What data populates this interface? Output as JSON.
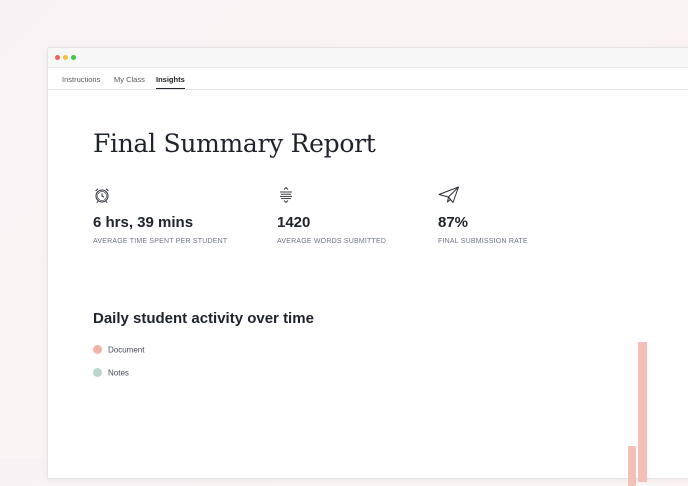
{
  "tabs": [
    {
      "label": "Instructions",
      "active": false
    },
    {
      "label": "My Class",
      "active": false
    },
    {
      "label": "Insights",
      "active": true
    }
  ],
  "report": {
    "title": "Final Summary Report"
  },
  "stats": [
    {
      "icon": "alarm-clock-icon",
      "value": "6 hrs, 39 mins",
      "label": "AVERAGE TIME SPENT PER STUDENT"
    },
    {
      "icon": "text-lines-icon",
      "value": "1420",
      "label": "AVERAGE WORDS SUBMITTED"
    },
    {
      "icon": "paper-plane-icon",
      "value": "87%",
      "label": "FINAL SUBMISSION RATE"
    }
  ],
  "activity": {
    "title": "Daily student activity over time",
    "legend": [
      {
        "name": "Document",
        "color": "#f3b3ab"
      },
      {
        "name": "Notes",
        "color": "#b9d6cc"
      }
    ]
  },
  "colors": {
    "bar": "#f3bfb7",
    "text_dark": "#1f232b",
    "label_gray": "#6f7682"
  }
}
